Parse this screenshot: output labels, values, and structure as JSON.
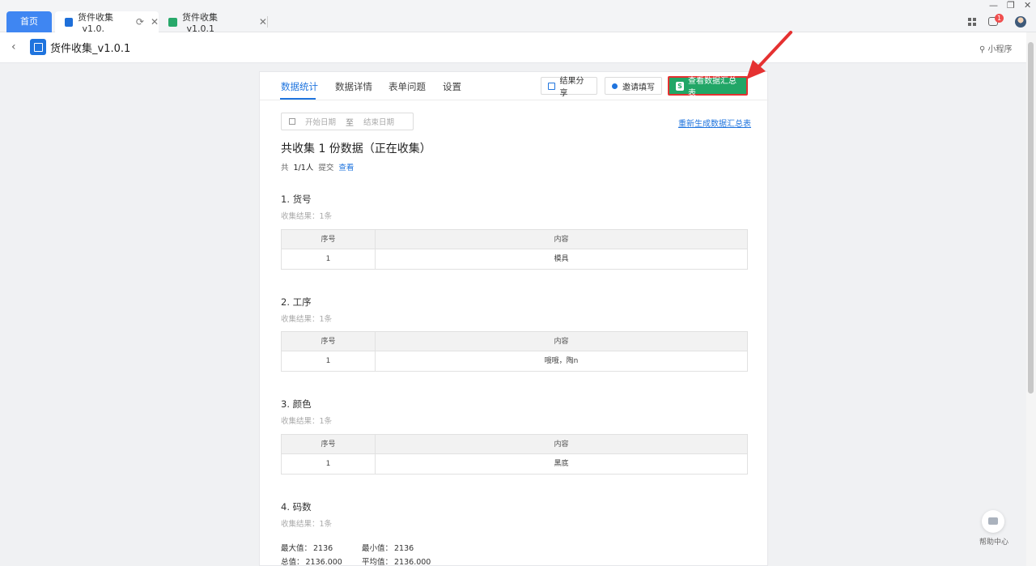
{
  "tabs": {
    "home": "首页",
    "tab1": "货件收集_v1.0.",
    "tab2": "货件收集_v1.0.1"
  },
  "window": {
    "notification_count": "1"
  },
  "header": {
    "title": "货件收集_v1.0.1",
    "mini_program": "小程序"
  },
  "nav": {
    "tabs": [
      "数据统计",
      "数据详情",
      "表单问题",
      "设置"
    ],
    "share_button": "结果分享",
    "invite_button": "邀请填写",
    "summary_button": "查看数据汇总表",
    "summary_badge": "S"
  },
  "filter": {
    "start_placeholder": "开始日期",
    "separator": "至",
    "end_placeholder": "结束日期",
    "regen_link": "重新生成数据汇总表"
  },
  "summary": {
    "title": "共收集 1 份数据（正在收集）",
    "prefix": "共",
    "count": "1/1人",
    "submitted": "提交",
    "view_link": "查看"
  },
  "questions": [
    {
      "title": "1.  货号",
      "result": "收集结果：1条",
      "headers": [
        "序号",
        "内容"
      ],
      "rows": [
        [
          "1",
          "模具"
        ]
      ]
    },
    {
      "title": "2.  工序",
      "result": "收集结果：1条",
      "headers": [
        "序号",
        "内容"
      ],
      "rows": [
        [
          "1",
          "哦哦，陶n"
        ]
      ]
    },
    {
      "title": "3.  颜色",
      "result": "收集结果：1条",
      "headers": [
        "序号",
        "内容"
      ],
      "rows": [
        [
          "1",
          "黑底"
        ]
      ]
    },
    {
      "title": "4.  码数",
      "result": "收集结果：1条"
    }
  ],
  "stats": {
    "max_label": "最大值：",
    "max_value": "2136",
    "min_label": "最小值：",
    "min_value": "2136",
    "total_label": "总值：",
    "total_value": "2136.000",
    "avg_label": "平均值：",
    "avg_value": "2136.000"
  },
  "help": {
    "label": "帮助中心"
  },
  "colors": {
    "accent": "#1f74de",
    "summary_button": "#21a666",
    "highlight": "#e53131"
  }
}
